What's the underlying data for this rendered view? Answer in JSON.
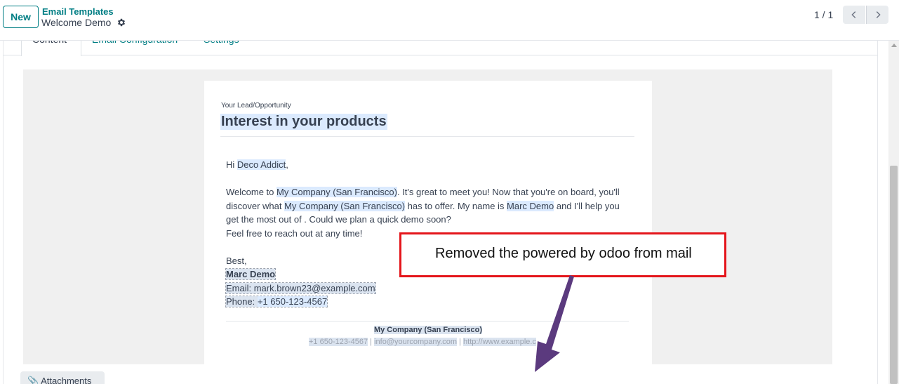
{
  "control_panel": {
    "new_label": "New",
    "breadcrumb_parent": "Email Templates",
    "breadcrumb_current": "Welcome Demo",
    "pager_value": "1 / 1"
  },
  "tabs": [
    {
      "label": "Content",
      "active": true
    },
    {
      "label": "Email Configuration",
      "active": false
    },
    {
      "label": "Settings",
      "active": false
    }
  ],
  "mail": {
    "eyebrow": "Your Lead/Opportunity",
    "title": "Interest in your products",
    "greeting_prefix": "Hi ",
    "customer_name": "Deco Addict",
    "greeting_suffix": ",",
    "p1_a": "Welcome to ",
    "company": "My Company (San Francisco)",
    "p1_b": ". It's great to meet you! Now that you're on board, you'll discover what ",
    "p1_c": " has to offer. My name is ",
    "user_name": "Marc Demo",
    "p1_d": " and I'll help you get the most out of . Could we plan a quick demo soon?",
    "p2": "Feel free to reach out at any time!",
    "sign_off": "Best,",
    "sig_name": "Marc Demo",
    "sig_email": "Email: mark.brown23@example.com",
    "sig_phone_label": "Phone: ",
    "sig_phone": "+1 650-123-4567",
    "footer_company": "My Company (San Francisco)",
    "footer_phone": "+1 650-123-4567",
    "footer_sep": " | ",
    "footer_email": "info@yourcompany.com",
    "footer_web": "http://www.example.c"
  },
  "annotation": {
    "text": "Removed the powered by odoo from mail",
    "border_color": "#e4151b",
    "arrow_color": "#5b3a7e"
  },
  "attachments_label": "Attachments",
  "colors": {
    "accent": "#017e84",
    "placeholder_highlight": "#dbeafe"
  }
}
